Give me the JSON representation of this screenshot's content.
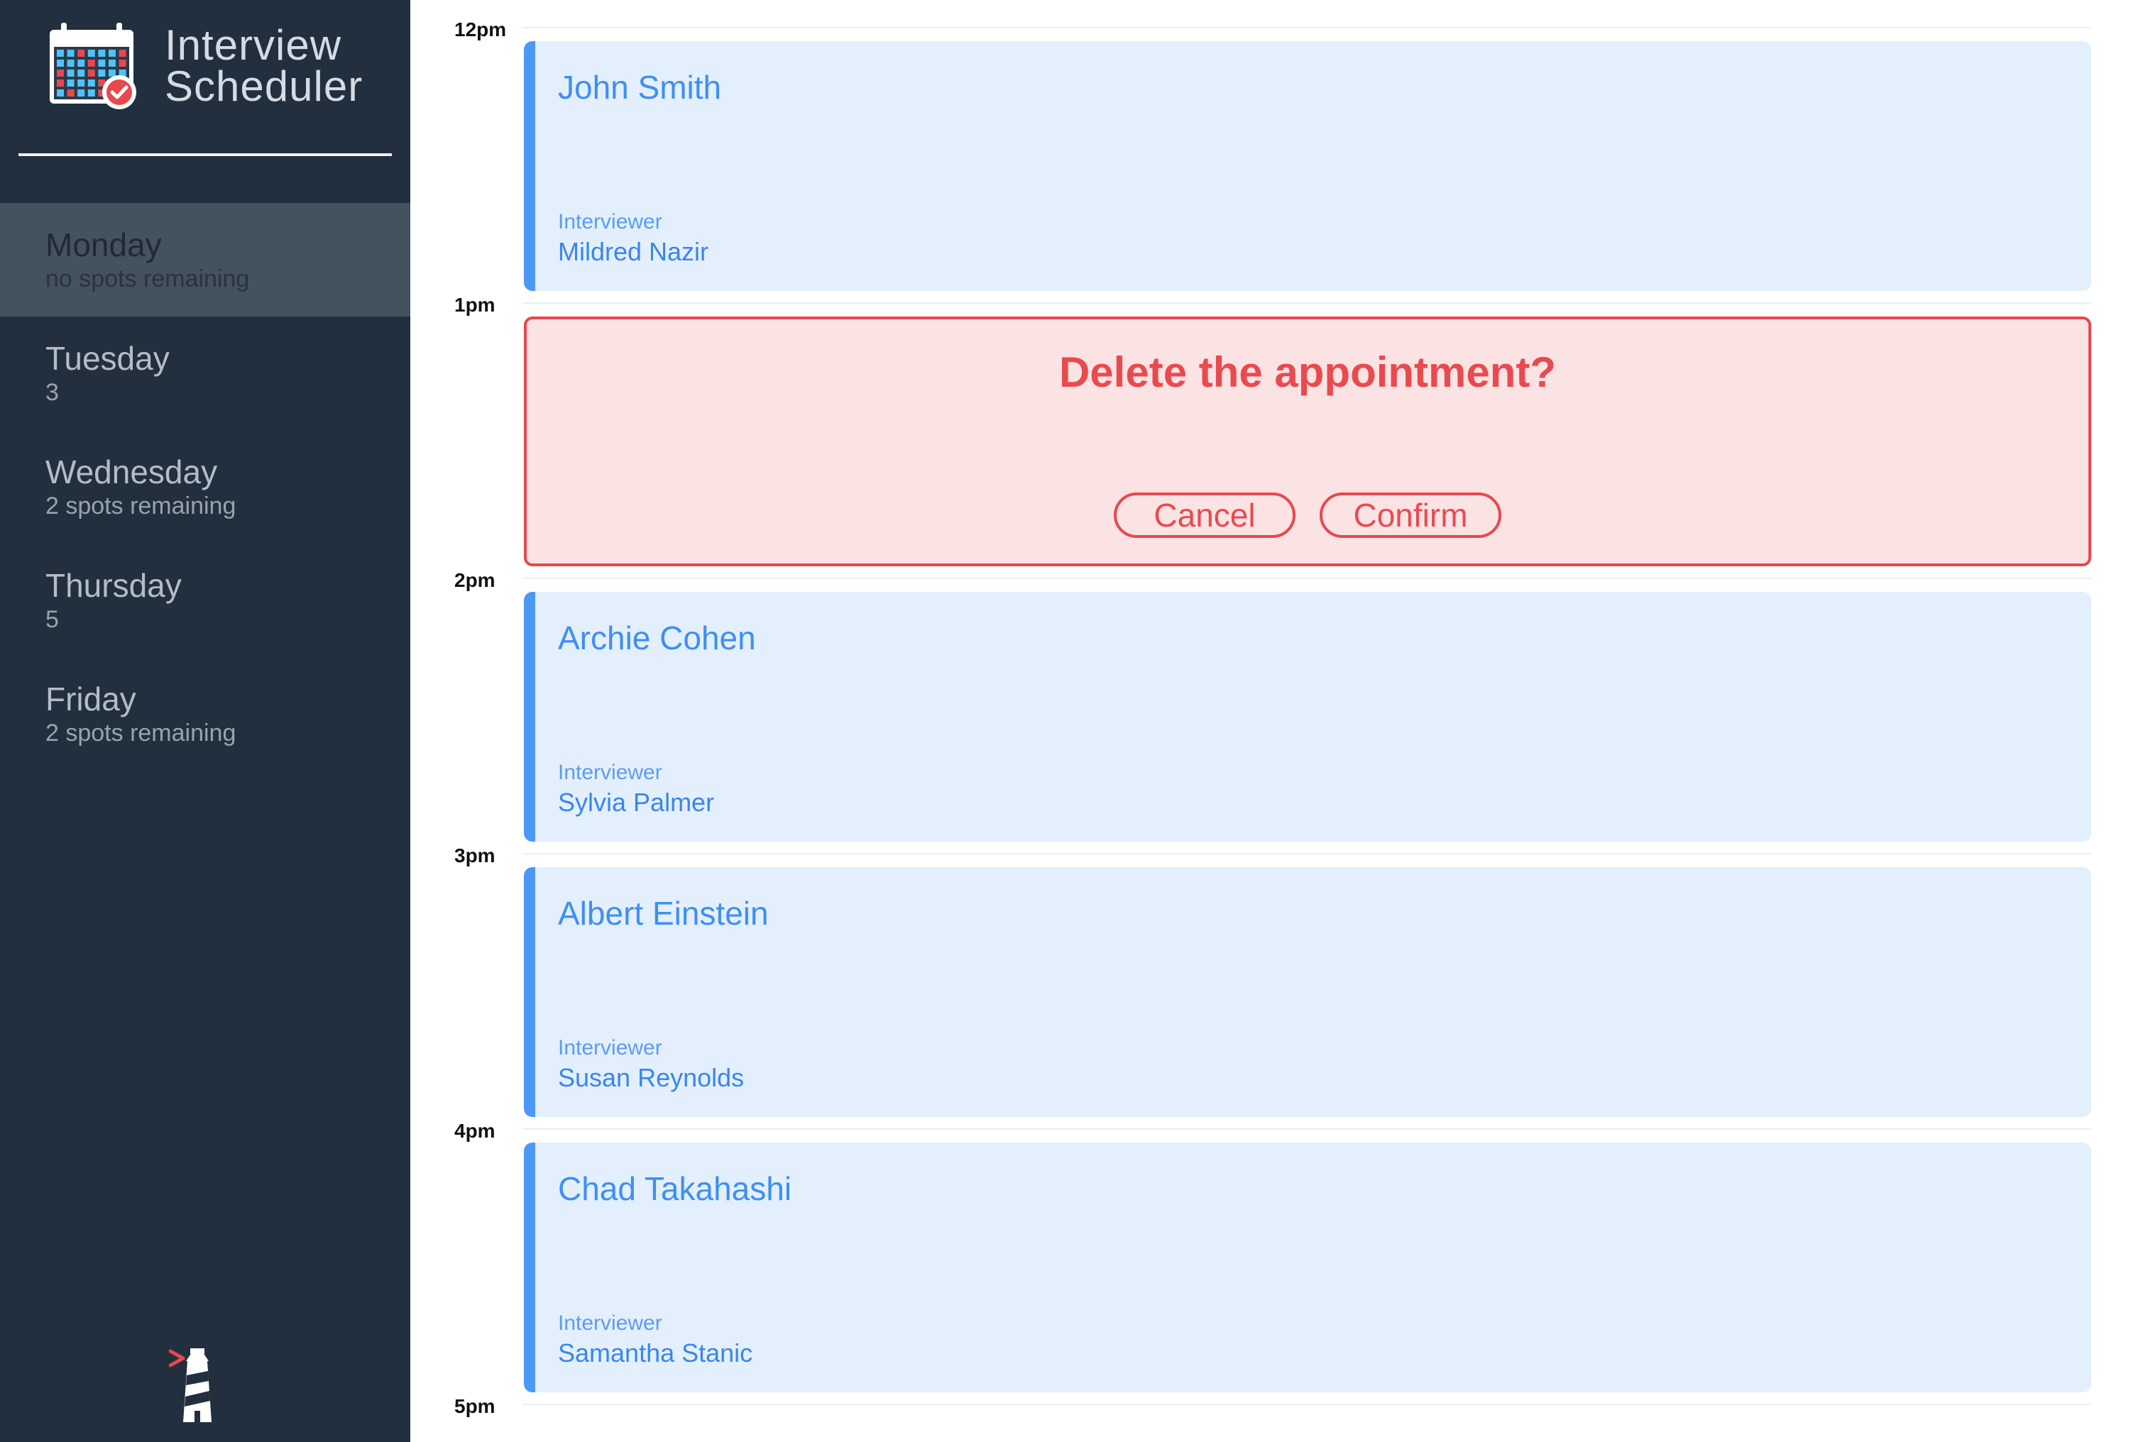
{
  "app": {
    "title_line1": "Interview",
    "title_line2": "Scheduler",
    "logo_icon": "calendar-check-icon",
    "footer_icon": "lighthouse-icon"
  },
  "days": [
    {
      "name": "Monday",
      "spots": "no spots remaining",
      "selected": true
    },
    {
      "name": "Tuesday",
      "spots": "3",
      "selected": false
    },
    {
      "name": "Wednesday",
      "spots": "2 spots remaining",
      "selected": false
    },
    {
      "name": "Thursday",
      "spots": "5",
      "selected": false
    },
    {
      "name": "Friday",
      "spots": "2 spots remaining",
      "selected": false
    }
  ],
  "times": [
    "12pm",
    "1pm",
    "2pm",
    "3pm",
    "4pm",
    "5pm"
  ],
  "appointments": [
    {
      "time": "12pm",
      "student": "John Smith",
      "interviewer_label": "Interviewer",
      "interviewer": "Mildred Nazir"
    },
    {
      "time": "1pm",
      "confirm": {
        "message": "Delete the appointment?",
        "cancel": "Cancel",
        "confirm": "Confirm"
      }
    },
    {
      "time": "2pm",
      "student": "Archie Cohen",
      "interviewer_label": "Interviewer",
      "interviewer": "Sylvia Palmer"
    },
    {
      "time": "3pm",
      "student": "Albert Einstein",
      "interviewer_label": "Interviewer",
      "interviewer": "Susan Reynolds"
    },
    {
      "time": "4pm",
      "student": "Chad Takahashi",
      "interviewer_label": "Interviewer",
      "interviewer": "Samantha Stanic"
    }
  ],
  "colors": {
    "sidebar_bg": "#222f3e",
    "selected_day_bg": "#44515f",
    "card_bg": "#e3effd",
    "card_accent": "#4d97f7",
    "danger": "#e8484e",
    "danger_bg": "#fbe3e4"
  }
}
